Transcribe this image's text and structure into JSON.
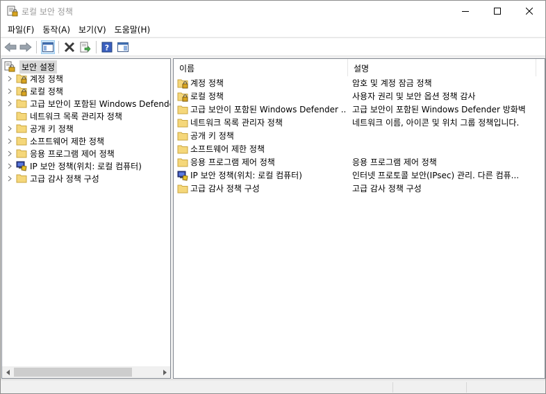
{
  "window": {
    "title": "로컬 보안 정책"
  },
  "menu": [
    {
      "label": "파일(F)"
    },
    {
      "label": "동작(A)"
    },
    {
      "label": "보기(V)"
    },
    {
      "label": "도움말(H)"
    }
  ],
  "toolbar": {
    "icons": [
      "back-arrow-icon",
      "forward-arrow-icon",
      "show-hide-console-tree-icon",
      "delete-icon",
      "export-list-icon",
      "help-icon",
      "properties-pane-icon"
    ]
  },
  "tree": {
    "root": "보안 설정",
    "items": [
      {
        "label": "계정 정책",
        "icon": "lock-folder"
      },
      {
        "label": "로컬 정책",
        "icon": "lock-folder"
      },
      {
        "label": "고급 보안이 포함된 Windows Defender 방화벽",
        "icon": "folder"
      },
      {
        "label": "네트워크 목록 관리자 정책",
        "icon": "folder"
      },
      {
        "label": "공개 키 정책",
        "icon": "folder"
      },
      {
        "label": "소프트웨어 제한 정책",
        "icon": "folder"
      },
      {
        "label": "응용 프로그램 제어 정책",
        "icon": "folder"
      },
      {
        "label": "IP 보안 정책(위치: 로컬 컴퓨터)",
        "icon": "ipsec"
      },
      {
        "label": "고급 감사 정책 구성",
        "icon": "folder"
      }
    ]
  },
  "list": {
    "columns": [
      "이름",
      "설명"
    ],
    "rows": [
      {
        "name": "계정 정책",
        "desc": "암호 및 계정 잠금 정책",
        "icon": "lock-folder"
      },
      {
        "name": "로컬 정책",
        "desc": "사용자 권리 및 보안 옵션 정책 감사",
        "icon": "lock-folder"
      },
      {
        "name": "고급 보안이 포함된 Windows Defender ...",
        "desc": "고급 보안이 포함된 Windows Defender 방화벽",
        "icon": "folder"
      },
      {
        "name": "네트워크 목록 관리자 정책",
        "desc": "네트워크 이름, 아이콘 및 위치 그룹 정책입니다.",
        "icon": "folder"
      },
      {
        "name": "공개 키 정책",
        "desc": "",
        "icon": "folder"
      },
      {
        "name": "소프트웨어 제한 정책",
        "desc": "",
        "icon": "folder"
      },
      {
        "name": "응용 프로그램 제어 정책",
        "desc": "응용 프로그램 제어 정책",
        "icon": "folder"
      },
      {
        "name": "IP 보안 정책(위치: 로컬 컴퓨터)",
        "desc": "인터넷 프로토콜 보안(IPsec) 관리. 다른 컴퓨...",
        "icon": "ipsec"
      },
      {
        "name": "고급 감사 정책 구성",
        "desc": "고급 감사 정책 구성",
        "icon": "folder"
      }
    ]
  }
}
